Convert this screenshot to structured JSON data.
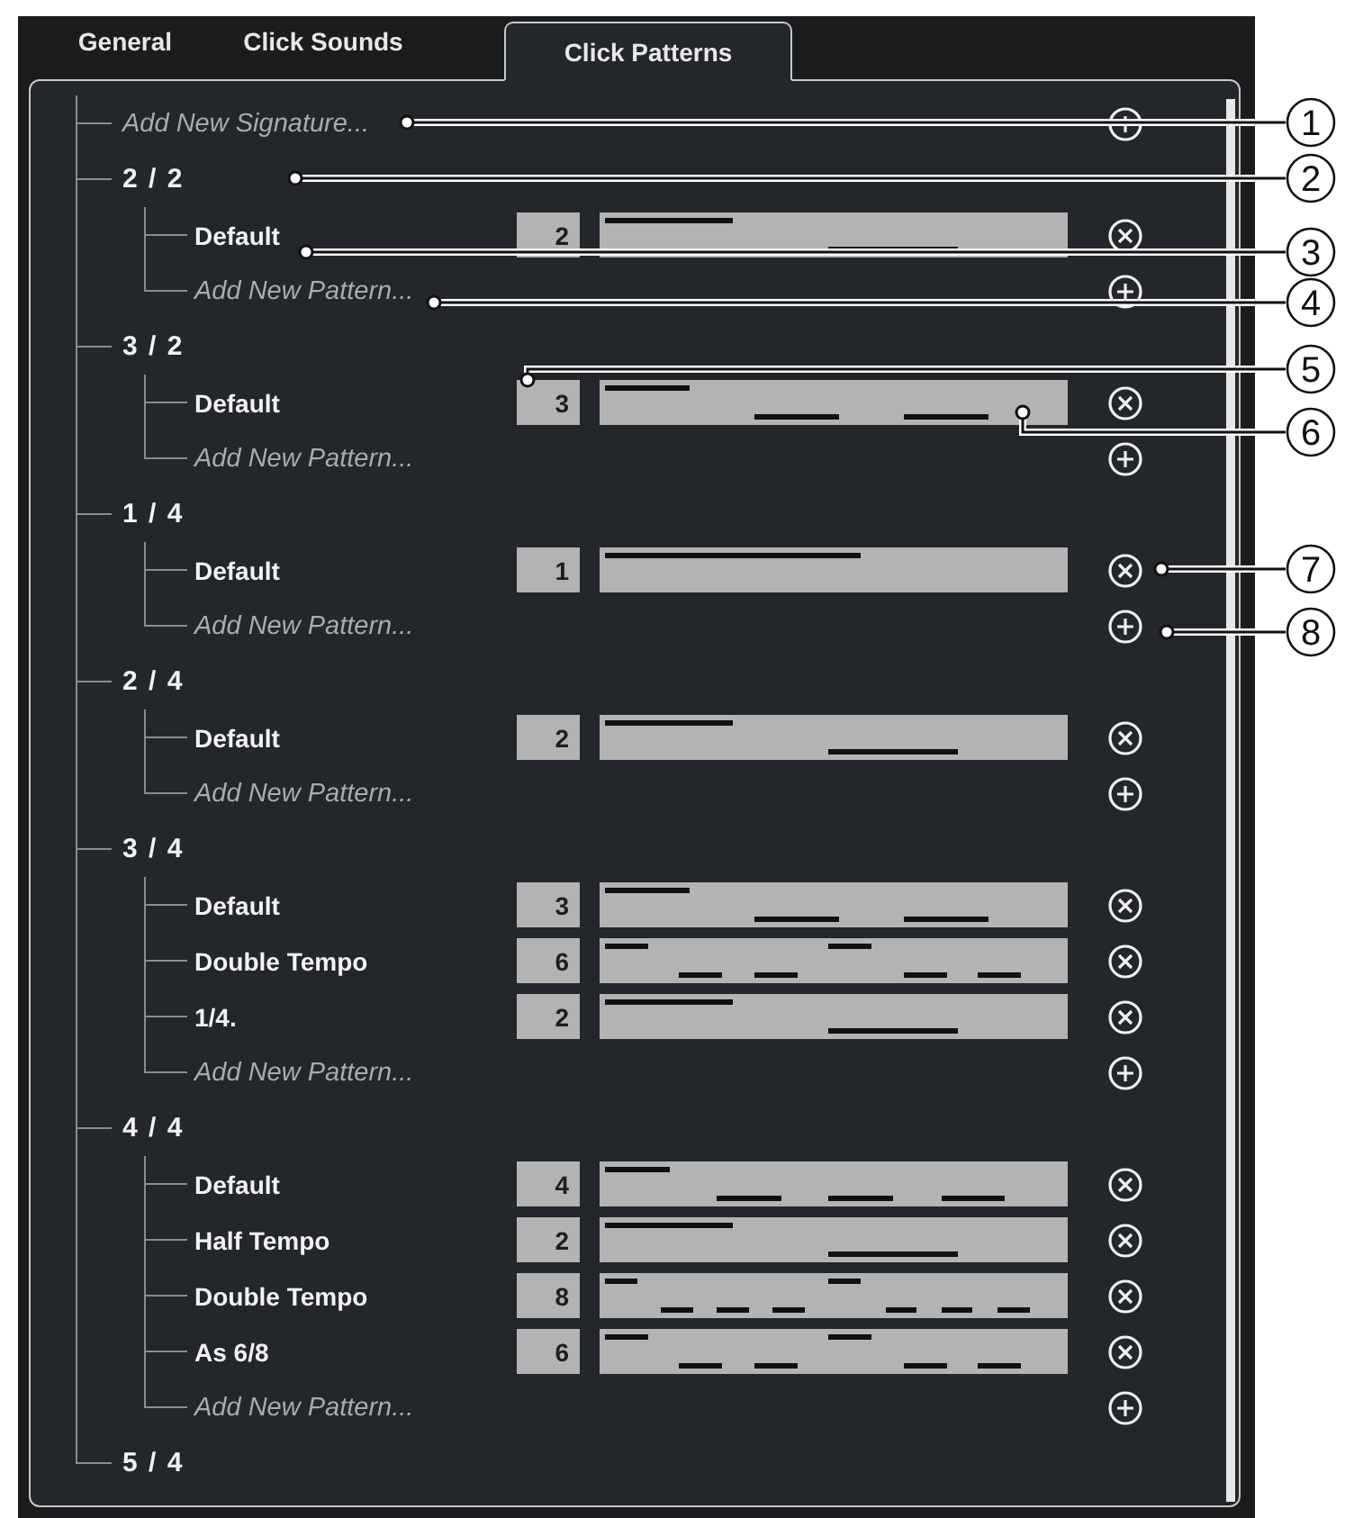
{
  "tabs": [
    {
      "label": "General",
      "selected": false
    },
    {
      "label": "Click Sounds",
      "selected": false
    },
    {
      "label": "Click Patterns",
      "selected": true
    }
  ],
  "tree": [
    {
      "kind": "add",
      "label": "Add New Signature..."
    },
    {
      "kind": "signature",
      "label": "2 / 2",
      "children": [
        {
          "kind": "pattern",
          "label": "Default",
          "count": "2",
          "beats": [
            {
              "accented": true
            },
            {
              "accented": false
            }
          ]
        },
        {
          "kind": "add",
          "label": "Add New Pattern..."
        }
      ]
    },
    {
      "kind": "signature",
      "label": "3 / 2",
      "children": [
        {
          "kind": "pattern",
          "label": "Default",
          "count": "3",
          "beats": [
            {
              "accented": true
            },
            {
              "accented": false
            },
            {
              "accented": false
            }
          ]
        },
        {
          "kind": "add",
          "label": "Add New Pattern..."
        }
      ]
    },
    {
      "kind": "signature",
      "label": "1 / 4",
      "children": [
        {
          "kind": "pattern",
          "label": "Default",
          "count": "1",
          "beats": [
            {
              "accented": true
            }
          ]
        },
        {
          "kind": "add",
          "label": "Add New Pattern..."
        }
      ]
    },
    {
      "kind": "signature",
      "label": "2 / 4",
      "children": [
        {
          "kind": "pattern",
          "label": "Default",
          "count": "2",
          "beats": [
            {
              "accented": true
            },
            {
              "accented": false
            }
          ]
        },
        {
          "kind": "add",
          "label": "Add New Pattern..."
        }
      ]
    },
    {
      "kind": "signature",
      "label": "3 / 4",
      "children": [
        {
          "kind": "pattern",
          "label": "Default",
          "count": "3",
          "beats": [
            {
              "accented": true
            },
            {
              "accented": false
            },
            {
              "accented": false
            }
          ]
        },
        {
          "kind": "pattern",
          "label": "Double Tempo",
          "count": "6",
          "beats": [
            {
              "accented": true
            },
            {
              "accented": false
            },
            {
              "accented": false
            },
            {
              "accented": true
            },
            {
              "accented": false
            },
            {
              "accented": false
            }
          ]
        },
        {
          "kind": "pattern",
          "label": "1/4.",
          "count": "2",
          "beats": [
            {
              "accented": true
            },
            {
              "accented": false
            }
          ]
        },
        {
          "kind": "add",
          "label": "Add New Pattern..."
        }
      ]
    },
    {
      "kind": "signature",
      "label": "4 / 4",
      "children": [
        {
          "kind": "pattern",
          "label": "Default",
          "count": "4",
          "beats": [
            {
              "accented": true
            },
            {
              "accented": false
            },
            {
              "accented": false
            },
            {
              "accented": false
            }
          ]
        },
        {
          "kind": "pattern",
          "label": "Half Tempo",
          "count": "2",
          "beats": [
            {
              "accented": true
            },
            {
              "accented": false
            }
          ]
        },
        {
          "kind": "pattern",
          "label": "Double Tempo",
          "count": "8",
          "beats": [
            {
              "accented": true
            },
            {
              "accented": false
            },
            {
              "accented": false
            },
            {
              "accented": false
            },
            {
              "accented": true
            },
            {
              "accented": false
            },
            {
              "accented": false
            },
            {
              "accented": false
            }
          ]
        },
        {
          "kind": "pattern",
          "label": "As 6/8",
          "count": "6",
          "beats": [
            {
              "accented": true
            },
            {
              "accented": false
            },
            {
              "accented": false
            },
            {
              "accented": true
            },
            {
              "accented": false
            },
            {
              "accented": false
            }
          ]
        },
        {
          "kind": "add",
          "label": "Add New Pattern..."
        }
      ]
    },
    {
      "kind": "signature",
      "label": "5 / 4"
    }
  ],
  "callouts": [
    "1",
    "2",
    "3",
    "4",
    "5",
    "6",
    "7",
    "8"
  ]
}
